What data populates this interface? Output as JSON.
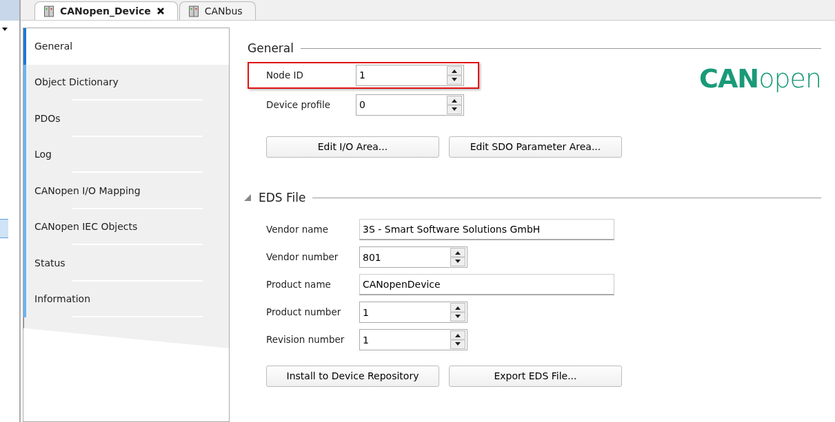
{
  "editor_tabs": [
    {
      "label": "CANopen_Device",
      "selected": true,
      "closable": true
    },
    {
      "label": "CANbus",
      "selected": false,
      "closable": false
    }
  ],
  "side_tabs": [
    {
      "label": "General",
      "selected": true
    },
    {
      "label": "Object Dictionary",
      "selected": false
    },
    {
      "label": "PDOs",
      "selected": false
    },
    {
      "label": "Log",
      "selected": false
    },
    {
      "label": "CANopen I/O Mapping",
      "selected": false
    },
    {
      "label": "CANopen IEC Objects",
      "selected": false
    },
    {
      "label": "Status",
      "selected": false
    },
    {
      "label": "Information",
      "selected": false
    }
  ],
  "general": {
    "title": "General",
    "fields": [
      {
        "kind": "spin",
        "label": "Node ID",
        "value": "1",
        "highlighted": true
      },
      {
        "kind": "spin",
        "label": "Device profile",
        "value": "0",
        "highlighted": false
      }
    ],
    "logo": "**CAN**open",
    "buttons": [
      "Edit I/O Area...",
      "Edit SDO Parameter Area..."
    ]
  },
  "eds_file": {
    "title": "EDS File",
    "expanded": true,
    "fields": [
      {
        "kind": "text",
        "label": "Vendor name",
        "value": "3S - Smart Software Solutions GmbH"
      },
      {
        "kind": "spin",
        "label": "Vendor number",
        "value": "801"
      },
      {
        "kind": "text",
        "label": "Product name",
        "value": "CANopenDevice"
      },
      {
        "kind": "spin",
        "label": "Product number",
        "value": "1"
      },
      {
        "kind": "spin",
        "label": "Revision number",
        "value": "1"
      }
    ],
    "buttons": [
      "Install to Device Repository",
      "Export EDS File..."
    ]
  }
}
